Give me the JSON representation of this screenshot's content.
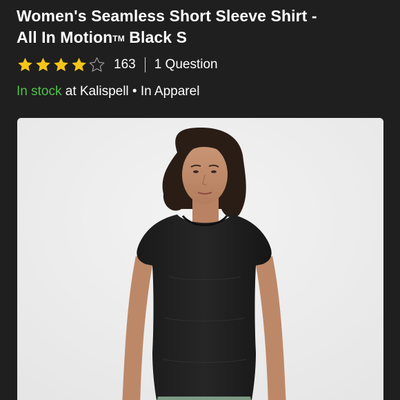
{
  "product": {
    "title_line1": "Women's Seamless Short Sleeve Shirt -",
    "title_line2_prefix": "All In Motion",
    "title_trademark": "TM",
    "title_line2_suffix": " Black S"
  },
  "rating": {
    "value": 4,
    "max": 5,
    "count": "163",
    "questions": "1 Question",
    "star_color": "#f5c518"
  },
  "availability": {
    "status": "In stock",
    "status_color": "#4fc04a",
    "location_text": " at Kalispell • In Apparel"
  },
  "image": {
    "icon": "product-photo",
    "background": "#efefef"
  }
}
